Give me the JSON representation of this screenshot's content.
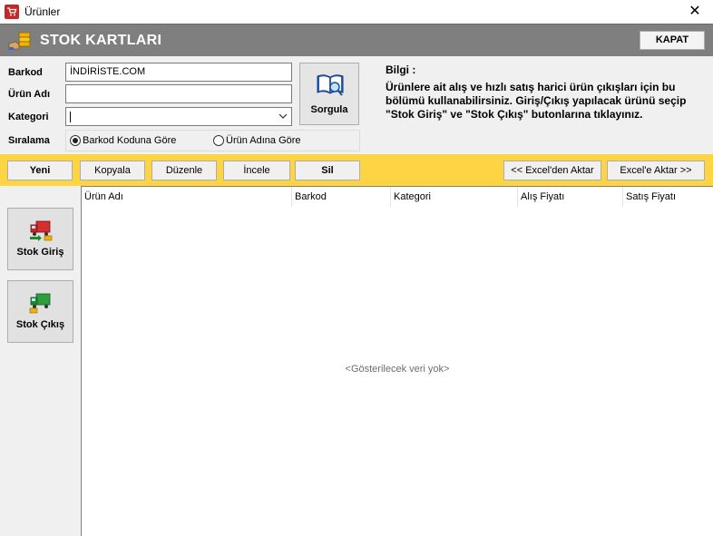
{
  "window": {
    "title": "Ürünler",
    "close_glyph": "✕"
  },
  "header": {
    "title": "STOK KARTLARI",
    "close_button": "KAPAT"
  },
  "form": {
    "barkod_label": "Barkod",
    "barkod_value": "İNDİRİSTE.COM",
    "urun_adi_label": "Ürün Adı",
    "urun_adi_value": "",
    "kategori_label": "Kategori",
    "kategori_value": "",
    "siralama_label": "Sıralama",
    "sort_options": [
      {
        "label": "Barkod Koduna  Göre",
        "selected": true
      },
      {
        "label": "Ürün Adına Göre",
        "selected": false
      }
    ],
    "query_button": "Sorgula"
  },
  "info": {
    "title": "Bilgi :",
    "text": "Ürünlere ait alış ve hızlı satış harici ürün çıkışları için bu bölümü kullanabilirsiniz. Giriş/Çıkış yapılacak ürünü seçip \"Stok Giriş\" ve \"Stok Çıkış\" butonlarına tıklayınız."
  },
  "toolbar": {
    "new": "Yeni",
    "copy": "Kopyala",
    "edit": "Düzenle",
    "inspect": "İncele",
    "delete": "Sil",
    "import_excel": "<< Excel'den Aktar",
    "export_excel": "Excel'e Aktar >>"
  },
  "sidebar": {
    "stock_in": "Stok Giriş",
    "stock_out": "Stok Çıkış"
  },
  "grid": {
    "columns": [
      "Ürün Adı",
      "Barkod",
      "Kategori",
      "Alış Fiyatı",
      "Satış Fiyatı"
    ],
    "empty_text": "<Gösterilecek veri yok>"
  },
  "colors": {
    "header_bg": "#7f7f7f",
    "toolbar_bg": "#fdd443",
    "form_bg": "#f0f0f0",
    "app_icon": "#c62828"
  },
  "icons": {
    "app": "cart-icon",
    "header": "coins-stack-icon",
    "query": "book-search-icon",
    "stock_in": "truck-in-icon",
    "stock_out": "truck-out-icon",
    "dropdown": "chevron-down-icon"
  }
}
